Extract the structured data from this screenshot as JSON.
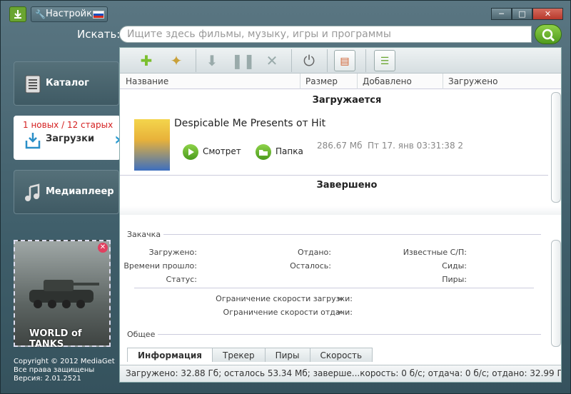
{
  "titlebar": {
    "settings_label": "Настройки",
    "minimize": "─",
    "maximize": "□",
    "close": "✕"
  },
  "search": {
    "label": "Искать:",
    "placeholder": "Ищите здесь фильмы, музыку, игры и программы"
  },
  "sidebar": {
    "catalog": "Каталог",
    "downloads": "Загрузки",
    "downloads_badge": "1 новых / 12 старых",
    "player": "Медиаплеер"
  },
  "ad": {
    "title": "WORLD of TANKS"
  },
  "copyright": {
    "line1": "Copyright © 2012 MediaGet",
    "line2": "Все права защищены",
    "line3": "Версия: 2.01.2521"
  },
  "columns": {
    "name": "Название",
    "size": "Размер",
    "added": "Добавлено",
    "saved": "Загружено"
  },
  "sections": {
    "downloading": "Загружается",
    "completed": "Завершено"
  },
  "download": {
    "title": "Despicable Me Presents от Hit",
    "watch": "Смотрет",
    "folder": "Папка",
    "size": "286.67 Мб",
    "date": "Пт 17. янв 03:31:38 2"
  },
  "details": {
    "group_transfer": "Закачка",
    "downloaded": "Загружено:",
    "elapsed": "Времени прошло:",
    "status": "Статус:",
    "uploaded": "Отдано:",
    "remaining": "Осталось:",
    "known_peers": "Известные С/П:",
    "seeds": "Сиды:",
    "peers": "Пиры:",
    "dl_limit": "Ограничение скорости загрузки:",
    "ul_limit": "Ограничение скорости отдачи:",
    "infinity": "∞",
    "group_general": "Общее"
  },
  "tabs": [
    "Информация",
    "Трекер",
    "Пиры",
    "Скорость"
  ],
  "status_bar": "Загружено: 32.88 Гб; осталось 53.34 Мб; заверше...корость: 0 б/с; отдача: 0 б/с; отдано: 32.99 Гб"
}
